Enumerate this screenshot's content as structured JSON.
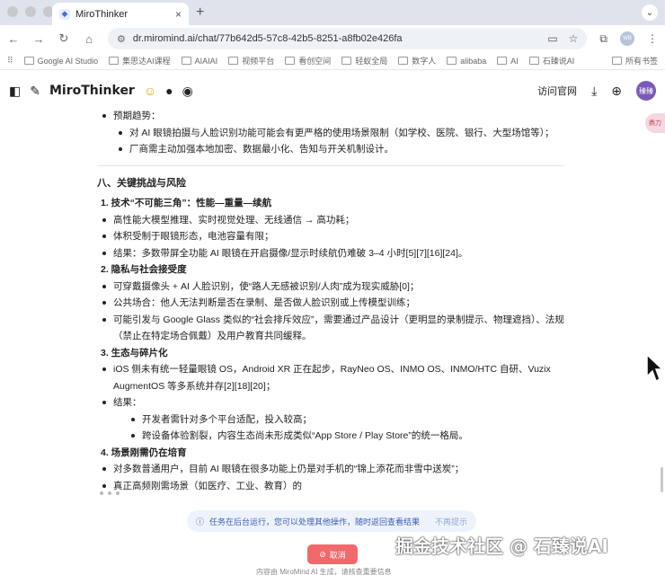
{
  "browser": {
    "tab_title": "MiroThinker",
    "url": "dr.miromind.ai/chat/77b642d5-57c8-42b5-8251-a8fb02e426fa",
    "profile": "WB",
    "bookmarks": [
      "Google AI Studio",
      "集思达AI课程",
      "AIAIAI",
      "视频平台",
      "看创空间",
      "轻蚁全局",
      "数字人",
      "alibaba",
      "AI",
      "石臻说AI"
    ],
    "bookmarks_all": "所有书签"
  },
  "app": {
    "brand": "MiroThinker",
    "visit_site": "访问官网",
    "user_avatar": "臻臻",
    "side_tag": "鼎力"
  },
  "content": {
    "trend_label": "预期趋势：",
    "trend_items": [
      "对 AI 眼镜拍摄与人脸识别功能可能会有更严格的使用场景限制（如学校、医院、银行、大型场馆等）；",
      "厂商需主动加强本地加密、数据最小化、告知与开关机制设计。"
    ],
    "section_title": "八、关键挑战与风险",
    "challenges": [
      {
        "title": "1. 技术“不可能三角”：性能—重量—续航",
        "items": [
          "高性能大模型推理、实时视觉处理、无线通信 → 高功耗；",
          "体积受制于眼镜形态，电池容量有限；",
          "结果：多数带屏全功能 AI 眼镜在开启摄像/显示时续航仍难破 3–4 小时[5][7][16][24]。"
        ]
      },
      {
        "title": "2. 隐私与社会接受度",
        "items": [
          "可穿戴摄像头 + AI 人脸识别，使“路人无感被识别/人肉”成为现实威胁[0]；",
          "公共场合：他人无法判断是否在录制、是否做人脸识别或上传模型训练；",
          "可能引发与 Google Glass 类似的“社会排斥效应”，需要通过产品设计（更明显的录制提示、物理遮挡）、法规（禁止在特定场合佩戴）及用户教育共同缓释。"
        ]
      }
    ],
    "eco_title": "3. 生态与碎片化",
    "eco_item": "iOS 侧未有统一轻量眼镜 OS，Android XR 正在起步，RayNeo OS、INMO OS、INMO/HTC 自研、Vuzix AugmentOS 等多系统并存[2][18][20]；",
    "eco_result_label": "结果：",
    "eco_results": [
      "开发者需针对多个平台适配，投入较高；",
      "跨设备体验割裂，内容生态尚未形成类似“App Store / Play Store”的统一格局。"
    ],
    "scene_title": "4. 场景刚需仍在培育",
    "scene_items": [
      "对多数普通用户，目前 AI 眼镜在很多功能上仍是对手机的“锦上添花而非雪中送炭”；",
      "真正高频刚需场景（如医疗、工业、教育）的"
    ]
  },
  "notice": {
    "text": "任务在后台运行，您可以处理其他操作，随时返回查看结果",
    "dismiss": "不再提示"
  },
  "cancel_label": "取消",
  "footer": "内容由 MiroMind AI 生成，请核查重要信息",
  "watermark": "掘金技术社区 @ 石臻说AI"
}
